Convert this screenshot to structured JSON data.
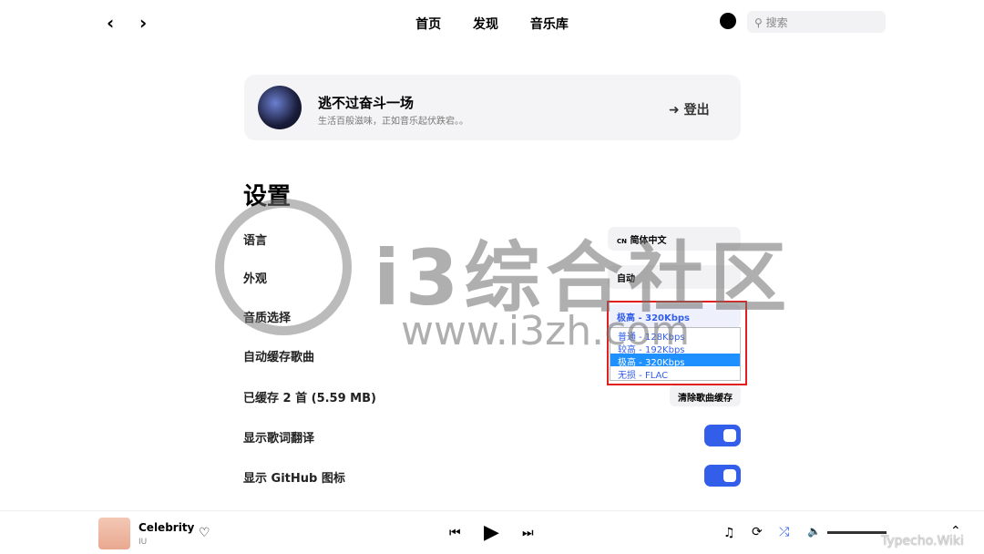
{
  "nav": {
    "back_icon": "chevron-left-icon",
    "forward_icon": "chevron-right-icon",
    "links": [
      "首页",
      "发现",
      "音乐库"
    ],
    "github_icon": "github-icon",
    "search_placeholder": "搜索"
  },
  "profile": {
    "name": "逃不过奋斗一场",
    "signature": "生活百般滋味，正如音乐起伏跌宕。。",
    "logout": "登出",
    "logout_icon": "sign-out-icon"
  },
  "settings": {
    "title": "设置",
    "language": {
      "label": "语言",
      "value": "简体中文",
      "flag": "CN"
    },
    "appearance": {
      "label": "外观",
      "value": "自动"
    },
    "quality": {
      "label": "音质选择",
      "value": "极高 - 320Kbps",
      "options": [
        "普通 - 128Kbps",
        "较高 - 192Kbps",
        "极高 - 320Kbps",
        "无损 - FLAC"
      ],
      "selected_index": 2
    },
    "auto_cache": {
      "label": "自动缓存歌曲"
    },
    "cached": {
      "label": "已缓存 2 首 (5.59 MB)",
      "button": "清除歌曲缓存"
    },
    "lyric_translation": {
      "label": "显示歌词翻译",
      "enabled": true
    },
    "github_icon_setting": {
      "label": "显示 GitHub 图标",
      "enabled": true
    },
    "accent": "#335eea"
  },
  "player": {
    "song": "Celebrity",
    "artist": "IU",
    "liked": false,
    "volume": 1.0
  },
  "watermark": {
    "text": "i3综合社区",
    "url": "www.i3zh.com",
    "corner": "Typecho.Wiki"
  }
}
